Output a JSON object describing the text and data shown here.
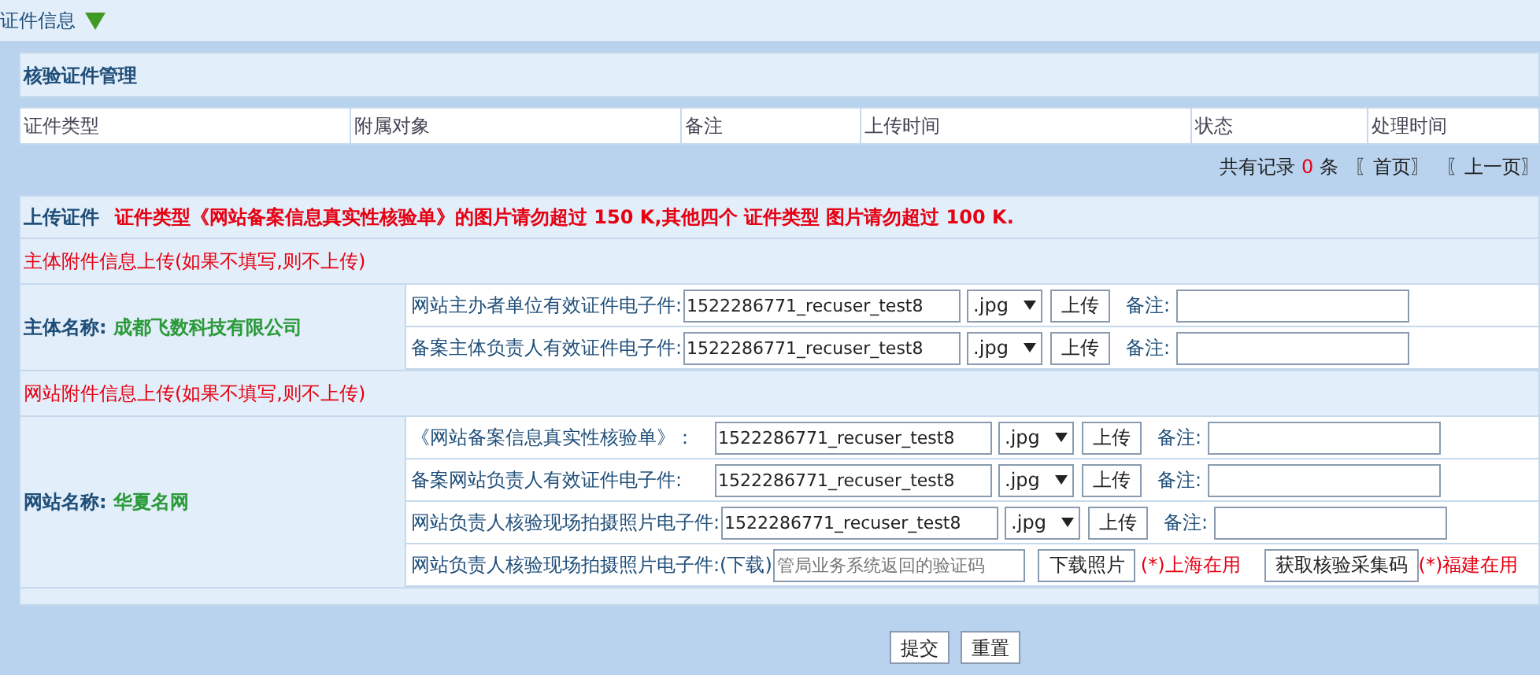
{
  "header": {
    "title": "证件信息"
  },
  "panel": {
    "title": "核验证件管理"
  },
  "table": {
    "columns": [
      "证件类型",
      "附属对象",
      "备注",
      "上传时间",
      "状态",
      "处理时间"
    ]
  },
  "pager": {
    "prefix": "共有记录",
    "count": "0",
    "suffix": "条",
    "links": [
      "〖首页〗",
      "〖上一页〗"
    ]
  },
  "upload": {
    "title": "上传证件",
    "notice": "证件类型《网站备案信息真实性核验单》的图片请勿超过 150 K,其他四个 证件类型 图片请勿超过 100 K."
  },
  "sections": [
    {
      "note": "主体附件信息上传(如果不填写,则不上传)",
      "name_label": "主体名称:",
      "name": "成都飞数科技有限公司",
      "rows": [
        {
          "kind": "upload",
          "label": "网站主办者单位有效证件电子件:",
          "file": "1522286771_recuser_test8",
          "format": ".jpg",
          "upload_button": "上传",
          "remark_label": "备注:"
        },
        {
          "kind": "upload",
          "label": "备案主体负责人有效证件电子件:",
          "file": "1522286771_recuser_test8",
          "format": ".jpg",
          "upload_button": "上传",
          "remark_label": "备注:"
        }
      ]
    },
    {
      "note": "网站附件信息上传(如果不填写,则不上传)",
      "name_label": "网站名称:",
      "name": "华夏名网",
      "rows": [
        {
          "kind": "upload",
          "label": "《网站备案信息真实性核验单》：",
          "file": "1522286771_recuser_test8",
          "format": ".jpg",
          "upload_button": "上传",
          "remark_label": "备注:"
        },
        {
          "kind": "upload",
          "label": "备案网站负责人有效证件电子件:",
          "file": "1522286771_recuser_test8",
          "format": ".jpg",
          "upload_button": "上传",
          "remark_label": "备注:"
        },
        {
          "kind": "upload",
          "label": "网站负责人核验现场拍摄照片电子件:",
          "file": "1522286771_recuser_test8",
          "format": ".jpg",
          "upload_button": "上传",
          "remark_label": "备注:"
        },
        {
          "kind": "download",
          "label": "网站负责人核验现场拍摄照片电子件:(下载)",
          "placeholder": "管局业务系统返回的验证码",
          "download_button": "下载照片",
          "download_note": "(*)上海在用",
          "code_button": "获取核验采集码",
          "code_note": "(*)福建在用"
        }
      ]
    }
  ],
  "actions": [
    "提交",
    "重置"
  ]
}
